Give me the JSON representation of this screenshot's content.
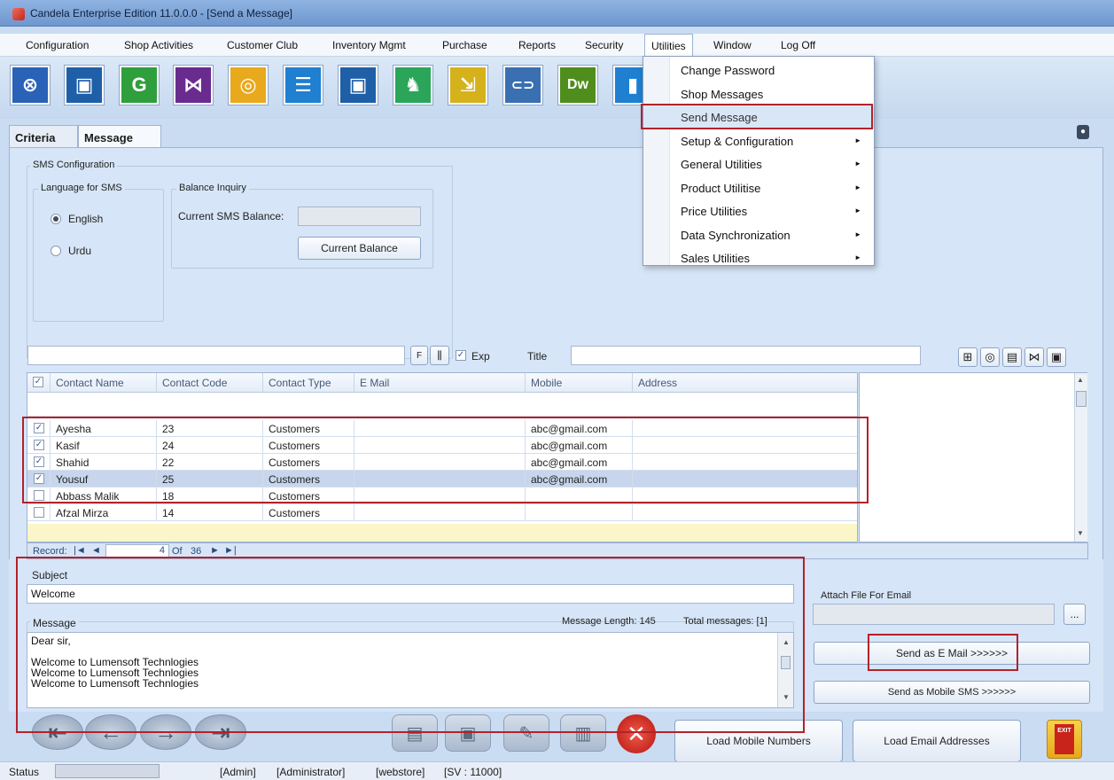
{
  "window": {
    "title": "Candela Enterprise Edition 11.0.0.0 - [Send a Message]"
  },
  "menu": {
    "items": [
      "Configuration",
      "Shop Activities",
      "Customer Club",
      "Inventory Mgmt",
      "Purchase",
      "Reports",
      "Security",
      "Utilities",
      "Window",
      "Log Off"
    ]
  },
  "toolbar": {
    "tiles": [
      {
        "name": "ie-icon",
        "glyph": "⊗",
        "color": "#2a62b8"
      },
      {
        "name": "mssql-icon",
        "glyph": "▣",
        "color": "#1e5fa8"
      },
      {
        "name": "google-icon",
        "glyph": "G",
        "color": "#2f9e3c"
      },
      {
        "name": "visual-studio-icon",
        "glyph": "⋈",
        "color": "#6a2b8f"
      },
      {
        "name": "outlook-icon",
        "glyph": "◎",
        "color": "#e9a91c"
      },
      {
        "name": "list-icon",
        "glyph": "☰",
        "color": "#1f7fd1"
      },
      {
        "name": "mssql2-icon",
        "glyph": "▣",
        "color": "#1e5fa8"
      },
      {
        "name": "game-icon",
        "glyph": "♞",
        "color": "#2aa55a"
      },
      {
        "name": "remote-icon",
        "glyph": "⇲",
        "color": "#d5b21c"
      },
      {
        "name": "link-icon",
        "glyph": "⊂⊃",
        "color": "#3a6fb2"
      },
      {
        "name": "dreamweaver-icon",
        "glyph": "Dw",
        "color": "#4f8d1d"
      },
      {
        "name": "extra-icon",
        "glyph": "▮",
        "color": "#1f7fd1"
      }
    ]
  },
  "dropdown": {
    "items": [
      {
        "label": "Change Password",
        "submenu": false
      },
      {
        "label": "Shop Messages",
        "submenu": false
      },
      {
        "label": "Send Message",
        "submenu": false
      },
      {
        "label": "Setup & Configuration",
        "submenu": true
      },
      {
        "label": "General Utilities",
        "submenu": true
      },
      {
        "label": "Product Utilitise",
        "submenu": true
      },
      {
        "label": "Price Utilities",
        "submenu": true
      },
      {
        "label": "Data Synchronization",
        "submenu": true
      },
      {
        "label": "Sales Utilities",
        "submenu": true
      }
    ],
    "arrow": "►"
  },
  "tabs": {
    "criteria": "Criteria",
    "message": "Message"
  },
  "sms": {
    "title": "SMS Configuration",
    "language_title": "Language for SMS",
    "english": "English",
    "urdu": "Urdu",
    "balance_title": "Balance Inquiry",
    "balance_label": "Current SMS Balance:",
    "balance_value": "",
    "balance_button": "Current Balance"
  },
  "filter": {
    "search_value": "",
    "f_label": "F",
    "exp_label": "Exp",
    "title_label": "Title",
    "title_value": ""
  },
  "grid": {
    "columns": [
      "Contact Name",
      "Contact Code",
      "Contact Type",
      "E Mail",
      "Mobile",
      "Address"
    ],
    "rows": [
      {
        "checked": true,
        "name": "Ayesha",
        "code": "23",
        "type": "Customers",
        "email": "",
        "mobile": "abc@gmail.com",
        "address": ""
      },
      {
        "checked": true,
        "name": "Kasif",
        "code": "24",
        "type": "Customers",
        "email": "",
        "mobile": "abc@gmail.com",
        "address": ""
      },
      {
        "checked": true,
        "name": "Shahid",
        "code": "22",
        "type": "Customers",
        "email": "",
        "mobile": "abc@gmail.com",
        "address": ""
      },
      {
        "checked": true,
        "name": "Yousuf",
        "code": "25",
        "type": "Customers",
        "email": "",
        "mobile": "abc@gmail.com",
        "address": ""
      },
      {
        "checked": false,
        "name": "Abbass Malik",
        "code": "18",
        "type": "Customers",
        "email": "",
        "mobile": "",
        "address": ""
      },
      {
        "checked": false,
        "name": "Afzal Mirza",
        "code": "14",
        "type": "Customers",
        "email": "",
        "mobile": "",
        "address": ""
      }
    ],
    "nav": {
      "record_label": "Record:",
      "current": "4",
      "of_label": "Of",
      "total": "36"
    }
  },
  "message": {
    "subject_label": "Subject",
    "subject_value": "Welcome",
    "message_label": "Message",
    "length_text": "Message Length: 145",
    "total_text": "Total messages: [1]",
    "body_lines": [
      "Dear sir,",
      "",
      "Welcome to Lumensoft Technlogies",
      "Welcome to Lumensoft Technlogies",
      "Welcome to Lumensoft Technlogies"
    ]
  },
  "attach": {
    "label": "Attach File For Email",
    "value": "",
    "browse": "...",
    "send_email": "Send as E Mail >>>>>>",
    "send_sms": "Send as Mobile SMS >>>>>>"
  },
  "bottom": {
    "load_mobile": "Load Mobile Numbers",
    "load_email": "Load Email Addresses",
    "exit": "EXIT"
  },
  "status": {
    "label": "Status",
    "user": "[Admin]",
    "role": "[Administrator]",
    "store": "[webstore]",
    "server": "[SV : 11000]"
  }
}
